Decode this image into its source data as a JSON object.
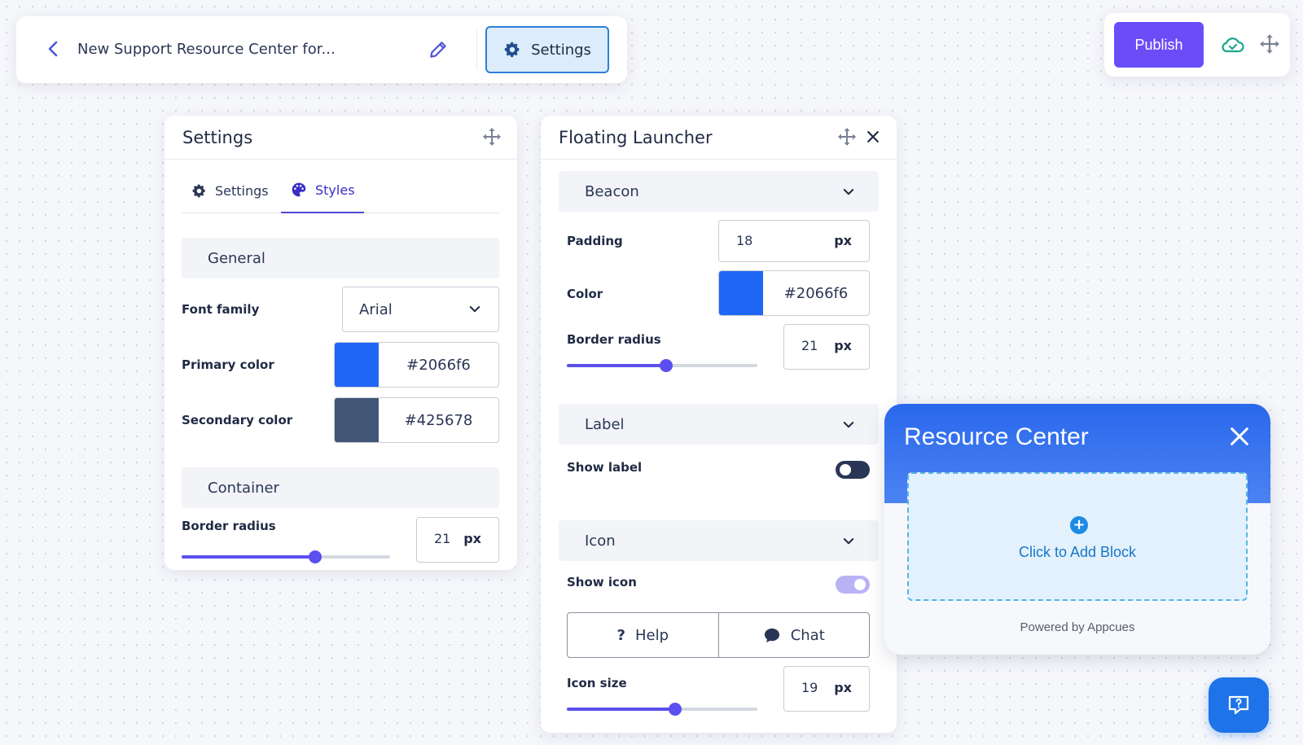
{
  "topbar": {
    "doc_title": "New Support Resource Center for...",
    "settings_label": "Settings"
  },
  "actions": {
    "publish_label": "Publish"
  },
  "settings_panel": {
    "title": "Settings",
    "tabs": [
      {
        "label": "Settings",
        "icon": "gear-icon",
        "active": false
      },
      {
        "label": "Styles",
        "icon": "palette-icon",
        "active": true
      }
    ],
    "general": {
      "heading": "General",
      "font_family_label": "Font family",
      "font_family_value": "Arial",
      "primary_color_label": "Primary color",
      "primary_color": "#2066f6",
      "secondary_color_label": "Secondary color",
      "secondary_color": "#425678"
    },
    "container": {
      "heading": "Container",
      "border_radius_label": "Border radius",
      "border_radius_value": "21",
      "border_radius_unit": "px",
      "border_radius_slider_fraction": 0.64
    }
  },
  "launcher_panel": {
    "title": "Floating Launcher",
    "beacon": {
      "heading": "Beacon",
      "padding_label": "Padding",
      "padding_value": "18",
      "padding_unit": "px",
      "color_label": "Color",
      "color_value": "#2066f6",
      "border_radius_label": "Border radius",
      "border_radius_value": "21",
      "border_radius_unit": "px",
      "border_radius_slider_fraction": 0.52
    },
    "label_section": {
      "heading": "Label",
      "show_label_label": "Show label",
      "show_label_on": false
    },
    "icon_section": {
      "heading": "Icon",
      "show_icon_label": "Show icon",
      "show_icon_on": true,
      "options": [
        {
          "label": "Help",
          "icon": "question-icon"
        },
        {
          "label": "Chat",
          "icon": "chat-bubble-icon"
        }
      ],
      "icon_size_label": "Icon size",
      "icon_size_value": "19",
      "icon_size_unit": "px",
      "icon_size_slider_fraction": 0.57
    }
  },
  "resource_center": {
    "title": "Resource Center",
    "add_block_label": "Click to Add Block",
    "powered_by": "Powered by Appcues"
  },
  "colors": {
    "accent": "#6b4cf6",
    "primary": "#2066f6",
    "secondary": "#425678"
  }
}
